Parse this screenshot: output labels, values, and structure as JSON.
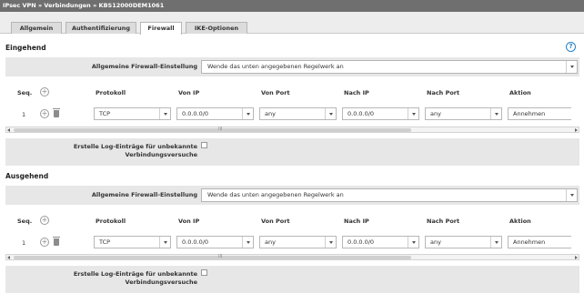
{
  "breadcrumb": "IPsec VPN » Verbindungen » KBS12000DEM1061",
  "tabs": [
    {
      "label": "Allgemein",
      "active": false
    },
    {
      "label": "Authentifizierung",
      "active": false
    },
    {
      "label": "Firewall",
      "active": true
    },
    {
      "label": "IKE-Optionen",
      "active": false
    }
  ],
  "help_icon": "question-icon",
  "incoming": {
    "title": "Eingehend",
    "setting_label": "Allgemeine Firewall-Einstellung",
    "setting_value": "Wende das unten angegebenen Regelwerk an",
    "headers": {
      "seq": "Seq.",
      "protocol": "Protokoll",
      "from_ip": "Von IP",
      "from_port": "Von Port",
      "to_ip": "Nach IP",
      "to_port": "Nach Port",
      "action": "Aktion"
    },
    "rows": [
      {
        "seq": "1",
        "protocol": "TCP",
        "from_ip": "0.0.0.0/0",
        "from_port": "any",
        "to_ip": "0.0.0.0/0",
        "to_port": "any",
        "action": "Annehmen"
      }
    ],
    "log_label_1": "Erstelle Log-Einträge für unbekannte",
    "log_label_2": "Verbindungsversuche",
    "log_checked": false
  },
  "outgoing": {
    "title": "Ausgehend",
    "setting_label": "Allgemeine Firewall-Einstellung",
    "setting_value": "Wende das unten angegebenen Regelwerk an",
    "headers": {
      "seq": "Seq.",
      "protocol": "Protokoll",
      "from_ip": "Von IP",
      "from_port": "Von Port",
      "to_ip": "Nach IP",
      "to_port": "Nach Port",
      "action": "Aktion"
    },
    "rows": [
      {
        "seq": "1",
        "protocol": "TCP",
        "from_ip": "0.0.0.0/0",
        "from_port": "any",
        "to_ip": "0.0.0.0/0",
        "to_port": "any",
        "action": "Annehmen"
      }
    ],
    "log_label_1": "Erstelle Log-Einträge für unbekannte",
    "log_label_2": "Verbindungsversuche",
    "log_checked": false
  },
  "colors": {
    "titlebar": "#6f6f6f",
    "accent": "#2a82c6",
    "row_bg": "#e7e7e7"
  }
}
